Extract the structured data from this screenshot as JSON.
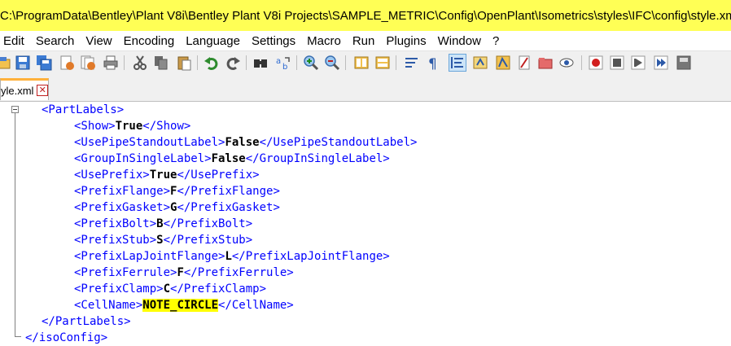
{
  "window": {
    "title": "C:\\ProgramData\\Bentley\\Plant V8i\\Bentley Plant V8i Projects\\SAMPLE_METRIC\\Config\\OpenPlant\\Isometrics\\styles\\IFC\\config\\style.xm..."
  },
  "menu": {
    "items": [
      "Edit",
      "Search",
      "View",
      "Encoding",
      "Language",
      "Settings",
      "Macro",
      "Run",
      "Plugins",
      "Window",
      "?"
    ]
  },
  "tab": {
    "name": "yle.xml",
    "close_glyph": "✕"
  },
  "editor": {
    "lines": [
      {
        "open": "<PartLabels>",
        "value": "",
        "close": "",
        "highlight": false
      },
      {
        "open": "<Show>",
        "value": "True",
        "close": "</Show>",
        "highlight": false
      },
      {
        "open": "<UsePipeStandoutLabel>",
        "value": "False",
        "close": "</UsePipeStandoutLabel>",
        "highlight": false
      },
      {
        "open": "<GroupInSingleLabel>",
        "value": "False",
        "close": "</GroupInSingleLabel>",
        "highlight": false
      },
      {
        "open": "<UsePrefix>",
        "value": "True",
        "close": "</UsePrefix>",
        "highlight": false
      },
      {
        "open": "<PrefixFlange>",
        "value": "F",
        "close": "</PrefixFlange>",
        "highlight": false
      },
      {
        "open": "<PrefixGasket>",
        "value": "G",
        "close": "</PrefixGasket>",
        "highlight": false
      },
      {
        "open": "<PrefixBolt>",
        "value": "B",
        "close": "</PrefixBolt>",
        "highlight": false
      },
      {
        "open": "<PrefixStub>",
        "value": "S",
        "close": "</PrefixStub>",
        "highlight": false
      },
      {
        "open": "<PrefixLapJointFlange>",
        "value": "L",
        "close": "</PrefixLapJointFlange>",
        "highlight": false
      },
      {
        "open": "<PrefixFerrule>",
        "value": "F",
        "close": "</PrefixFerrule>",
        "highlight": false
      },
      {
        "open": "<PrefixClamp>",
        "value": "C",
        "close": "</PrefixClamp>",
        "highlight": false
      },
      {
        "open": "<CellName>",
        "value": "NOTE_CIRCLE",
        "close": "</CellName>",
        "highlight": true
      },
      {
        "open": "</PartLabels>",
        "value": "",
        "close": "",
        "highlight": false
      },
      {
        "open": "</isoConfig>",
        "value": "",
        "close": "",
        "highlight": false
      }
    ]
  },
  "colors": {
    "title_bg": "#ffff55",
    "tag": "#0000ff",
    "highlight": "#ffff00",
    "tab_accent": "#ffb13b"
  }
}
